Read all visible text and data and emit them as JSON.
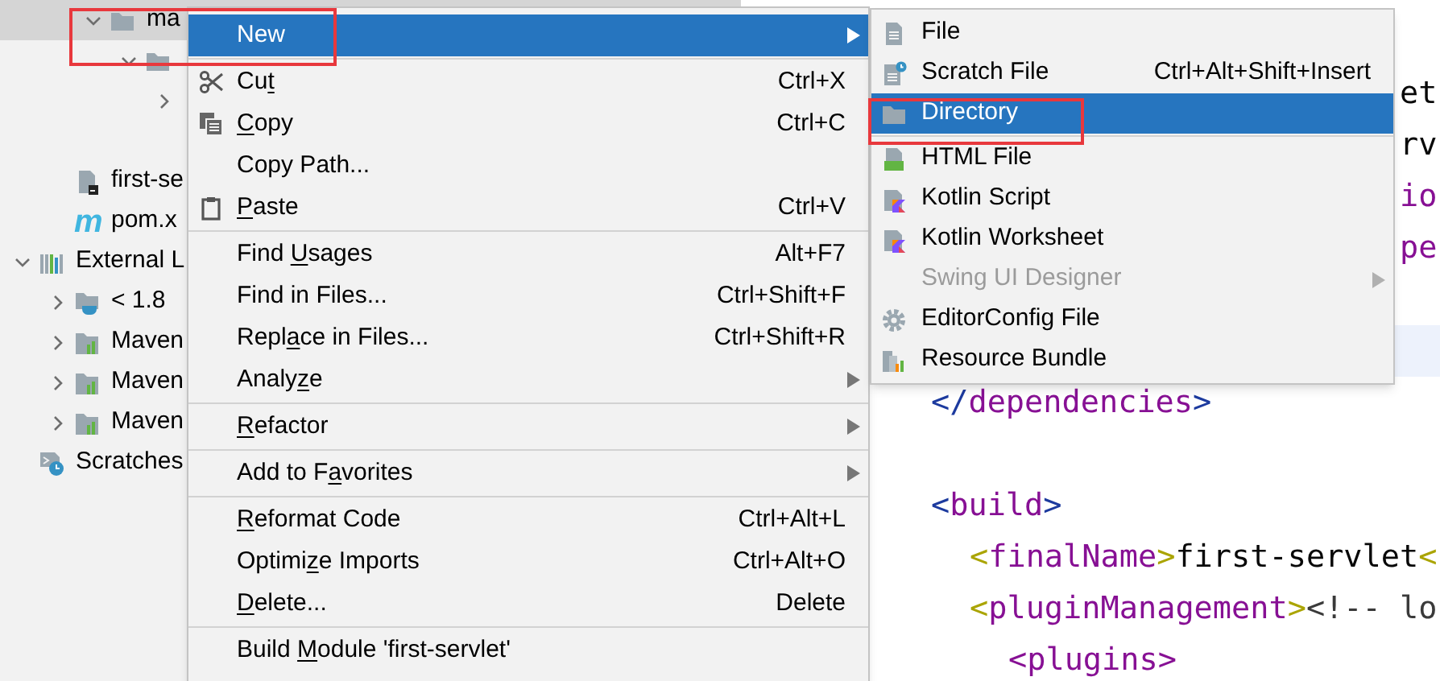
{
  "project_tree": [
    {
      "kind": "offscreen",
      "children": [
        {
          "kind": "offscreen",
          "children": [
            {
              "kind": "folder",
              "label": "ma",
              "expanded": true,
              "selected": true,
              "children": [
                {
                  "kind": "folder",
                  "expanded": true,
                  "selected": false,
                  "children": [
                    {
                      "expanded": false,
                      "selected": false
                    },
                    {
                      "selected": false
                    }
                  ]
                }
              ]
            }
          ]
        },
        {
          "kind": "file",
          "label": "first-se",
          "selected": false
        },
        {
          "kind": "pom",
          "glyph": "m",
          "label": "pom.x",
          "selected": false
        }
      ]
    },
    {
      "kind": "library",
      "label": "External L",
      "expanded": true,
      "selected": false,
      "children": [
        {
          "kind": "jdk",
          "label": "< 1.8",
          "expanded": false,
          "selected": false
        },
        {
          "kind": "maven",
          "label": "Maven",
          "expanded": false,
          "selected": false
        },
        {
          "kind": "maven",
          "label": "Maven",
          "expanded": false,
          "selected": false
        },
        {
          "kind": "maven",
          "label": "Maven",
          "expanded": false,
          "selected": false
        }
      ]
    },
    {
      "kind": "scratches",
      "label": "Scratches",
      "selected": false
    }
  ],
  "editor": {
    "lines": [
      {
        "kind": "tail",
        "segments": [
          {
            "kind": "text",
            "text": "et"
          }
        ]
      },
      {
        "kind": "tail",
        "segments": [
          {
            "kind": "text",
            "text": "rv"
          }
        ]
      },
      {
        "kind": "tail",
        "segments": [
          {
            "kind": "tag",
            "text": "io"
          }
        ]
      },
      {
        "kind": "tail",
        "segments": [
          {
            "kind": "tag",
            "text": "pe"
          }
        ]
      },
      {
        "kind": "blank"
      },
      {
        "kind": "current"
      },
      {
        "kind": "group",
        "children": [
          {
            "kind": "code",
            "segments": [
              {
                "kind": "bracket",
                "text": "</"
              },
              {
                "kind": "tag",
                "text": "dependencies"
              },
              {
                "kind": "bracket",
                "text": ">"
              }
            ]
          },
          {
            "kind": "blank"
          },
          {
            "kind": "code",
            "segments": [
              {
                "kind": "bracket",
                "text": "<"
              },
              {
                "kind": "tag",
                "text": "build"
              },
              {
                "kind": "bracket",
                "text": ">"
              }
            ],
            "children": [
              {
                "kind": "code",
                "segments": [
                  {
                    "kind": "match",
                    "text": "<"
                  },
                  {
                    "kind": "tag",
                    "text": "finalName"
                  },
                  {
                    "kind": "match",
                    "text": ">"
                  },
                  {
                    "kind": "text",
                    "text": "first-servlet"
                  },
                  {
                    "kind": "match",
                    "text": "<"
                  }
                ]
              },
              {
                "kind": "code",
                "segments": [
                  {
                    "kind": "match",
                    "text": "<"
                  },
                  {
                    "kind": "tag",
                    "text": "pluginManagement"
                  },
                  {
                    "kind": "match",
                    "text": ">"
                  },
                  {
                    "kind": "comment",
                    "text": "<!-- lo"
                  }
                ],
                "children": [
                  {
                    "kind": "code",
                    "segments": [
                      {
                        "kind": "tag",
                        "text": "<plugins>"
                      }
                    ]
                  }
                ]
              }
            ]
          }
        ]
      }
    ]
  },
  "context_menu": {
    "groups": [
      {
        "items": [
          {
            "kind": "plain",
            "label": {
              "pre": "New"
            },
            "submenu": true,
            "selected": true,
            "outlined": true
          }
        ]
      },
      {
        "items": [
          {
            "kind": "scissors",
            "label": {
              "pre": "Cu",
              "key": "t"
            },
            "shortcut": "Ctrl+X",
            "submenu": false,
            "selected": false,
            "outlined": false
          },
          {
            "kind": "copy",
            "label": {
              "key": "C",
              "post": "opy"
            },
            "shortcut": "Ctrl+C",
            "submenu": false,
            "selected": false,
            "outlined": false
          },
          {
            "kind": "plain",
            "label": {
              "pre": "Copy Path..."
            },
            "submenu": false,
            "selected": false,
            "outlined": false
          },
          {
            "kind": "clipboard",
            "label": {
              "key": "P",
              "post": "aste"
            },
            "shortcut": "Ctrl+V",
            "submenu": false,
            "selected": false,
            "outlined": false
          }
        ]
      },
      {
        "items": [
          {
            "kind": "plain",
            "label": {
              "pre": "Find ",
              "key": "U",
              "post": "sages"
            },
            "shortcut": "Alt+F7",
            "submenu": false,
            "selected": false,
            "outlined": false
          },
          {
            "kind": "plain",
            "label": {
              "pre": "Find in Files..."
            },
            "shortcut": "Ctrl+Shift+F",
            "submenu": false,
            "selected": false,
            "outlined": false
          },
          {
            "kind": "plain",
            "label": {
              "pre": "Repl",
              "key": "a",
              "post": "ce in Files..."
            },
            "shortcut": "Ctrl+Shift+R",
            "submenu": false,
            "selected": false,
            "outlined": false
          },
          {
            "kind": "plain",
            "label": {
              "pre": "Analy",
              "key": "z",
              "post": "e"
            },
            "submenu": true,
            "selected": false,
            "outlined": false
          }
        ]
      },
      {
        "items": [
          {
            "kind": "plain",
            "label": {
              "key": "R",
              "post": "efactor"
            },
            "submenu": true,
            "selected": false,
            "outlined": false
          }
        ]
      },
      {
        "items": [
          {
            "kind": "plain",
            "label": {
              "pre": "Add to F",
              "key": "a",
              "post": "vorites"
            },
            "submenu": true,
            "selected": false,
            "outlined": false
          }
        ]
      },
      {
        "items": [
          {
            "kind": "plain",
            "label": {
              "key": "R",
              "post": "eformat Code"
            },
            "shortcut": "Ctrl+Alt+L",
            "submenu": false,
            "selected": false,
            "outlined": false
          },
          {
            "kind": "plain",
            "label": {
              "pre": "Optimi",
              "key": "z",
              "post": "e Imports"
            },
            "shortcut": "Ctrl+Alt+O",
            "submenu": false,
            "selected": false,
            "outlined": false
          },
          {
            "kind": "plain",
            "label": {
              "key": "D",
              "post": "elete..."
            },
            "shortcut": "Delete",
            "submenu": false,
            "selected": false,
            "outlined": false
          }
        ]
      },
      {
        "items": [
          {
            "kind": "plain",
            "label": {
              "pre": "Build ",
              "key": "M",
              "post": "odule 'first-servlet'"
            },
            "submenu": false,
            "selected": false,
            "outlined": false
          }
        ]
      }
    ]
  },
  "new_submenu": {
    "groups": [
      {
        "items": [
          {
            "kind": "file",
            "label": {
              "pre": "File"
            },
            "submenu": false,
            "selected": false,
            "disabled": false,
            "outlined": false
          },
          {
            "kind": "scratch",
            "label": {
              "pre": "Scratch File"
            },
            "shortcut": "Ctrl+Alt+Shift+Insert",
            "submenu": false,
            "selected": false,
            "disabled": false,
            "outlined": false
          },
          {
            "kind": "folder",
            "label": {
              "pre": "Directory"
            },
            "submenu": false,
            "selected": true,
            "disabled": false,
            "outlined": true
          }
        ]
      },
      {
        "items": [
          {
            "kind": "html",
            "label": {
              "pre": "HTML File"
            },
            "submenu": false,
            "selected": false,
            "disabled": false,
            "outlined": false
          },
          {
            "kind": "kotlin",
            "label": {
              "pre": "Kotlin Script"
            },
            "submenu": false,
            "selected": false,
            "disabled": false,
            "outlined": false
          },
          {
            "kind": "kotlin",
            "label": {
              "pre": "Kotlin Worksheet"
            },
            "submenu": false,
            "selected": false,
            "disabled": false,
            "outlined": false
          },
          {
            "kind": "plain",
            "label": {
              "pre": "Swing UI Designer"
            },
            "submenu": true,
            "selected": false,
            "disabled": true,
            "outlined": false
          },
          {
            "kind": "gear",
            "label": {
              "pre": "EditorConfig File"
            },
            "submenu": false,
            "selected": false,
            "disabled": false,
            "outlined": false
          },
          {
            "kind": "bundle",
            "label": {
              "pre": "Resource Bundle"
            },
            "submenu": false,
            "selected": false,
            "disabled": false,
            "outlined": false
          }
        ]
      }
    ]
  }
}
